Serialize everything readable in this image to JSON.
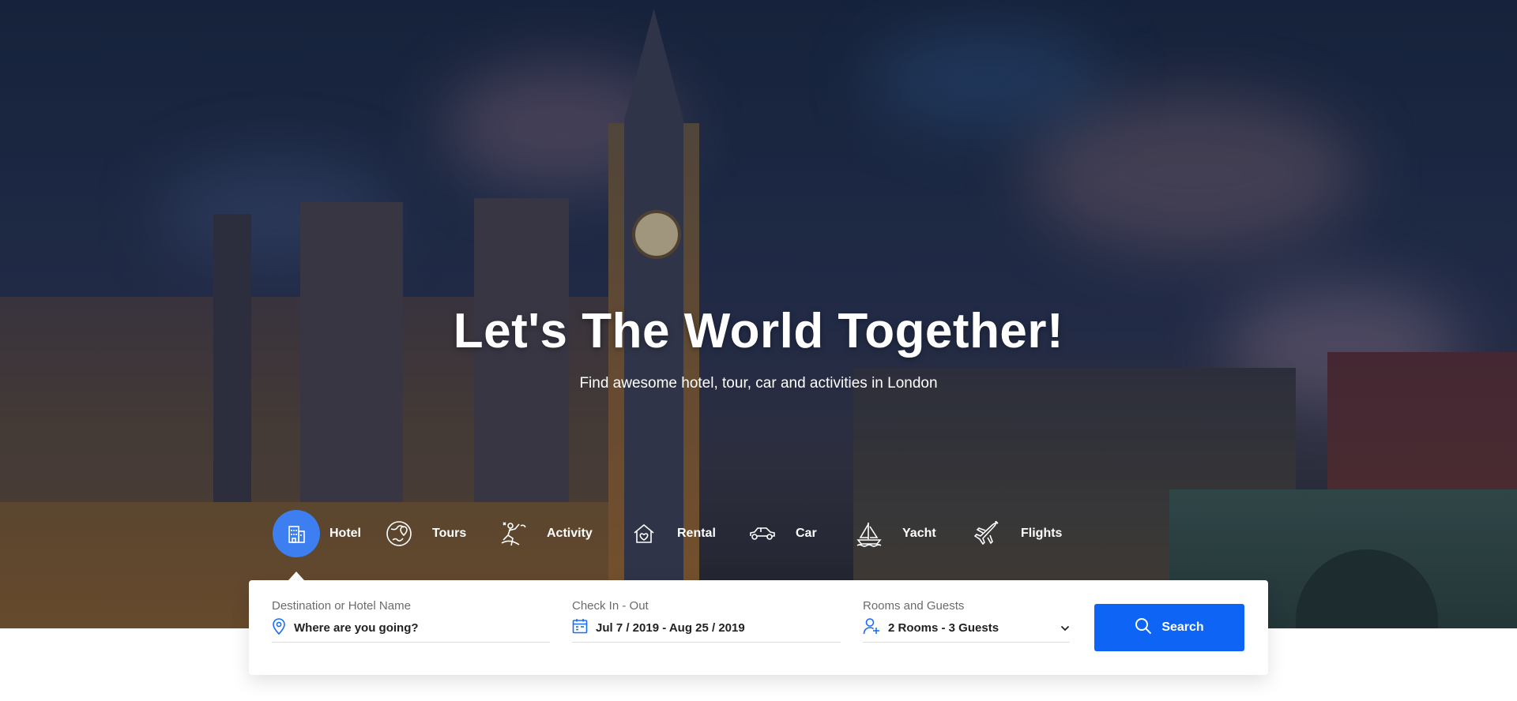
{
  "hero": {
    "title": "Let's The World Together!",
    "subtitle": "Find awesome hotel, tour, car and activities in London"
  },
  "tabs": [
    {
      "label": "Hotel",
      "icon": "hotel-icon",
      "active": true
    },
    {
      "label": "Tours",
      "icon": "tours-icon",
      "active": false
    },
    {
      "label": "Activity",
      "icon": "activity-icon",
      "active": false
    },
    {
      "label": "Rental",
      "icon": "rental-icon",
      "active": false
    },
    {
      "label": "Car",
      "icon": "car-icon",
      "active": false
    },
    {
      "label": "Yacht",
      "icon": "yacht-icon",
      "active": false
    },
    {
      "label": "Flights",
      "icon": "flights-icon",
      "active": false
    }
  ],
  "search": {
    "destination": {
      "label": "Destination or Hotel Name",
      "placeholder": "Where are you going?",
      "icon": "map-pin-icon"
    },
    "dates": {
      "label": "Check In - Out",
      "value": "Jul 7 / 2019 - Aug 25 / 2019",
      "icon": "calendar-icon"
    },
    "guests": {
      "label": "Rooms and Guests",
      "value": "2 Rooms - 3 Guests",
      "icon": "user-add-icon"
    },
    "button_label": "Search",
    "button_icon": "search-icon"
  },
  "colors": {
    "accent": "#0d64f5",
    "active_tab": "#3d7ff0",
    "icon_blue": "#1a6ef5"
  }
}
